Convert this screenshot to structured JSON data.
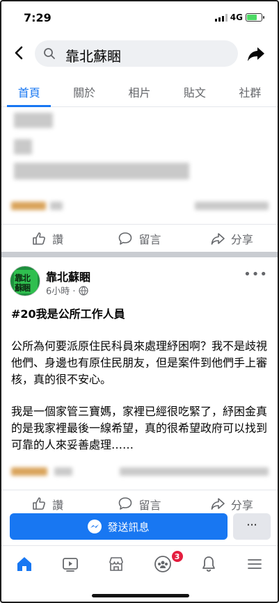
{
  "status": {
    "time": "7:29",
    "network": "4G"
  },
  "header": {
    "search_query": "靠北蘇睏"
  },
  "tabs": [
    {
      "label": "首頁",
      "active": true
    },
    {
      "label": "關於",
      "active": false
    },
    {
      "label": "相片",
      "active": false
    },
    {
      "label": "貼文",
      "active": false
    },
    {
      "label": "社群",
      "active": false
    }
  ],
  "actions": {
    "like": "讚",
    "comment": "留言",
    "share": "分享"
  },
  "post": {
    "page_name": "靠北蘇睏",
    "avatar_text_line1": "靠北",
    "avatar_text_line2": "蘇睏",
    "time": "6小時 ·",
    "title": "#20我是公所工作人員",
    "paragraph1": "公所為何要派原住民科員來處理紓困啊？我不是歧視他們、身邊也有原住民朋友，但是案件到他們手上審核，真的很不安心。",
    "paragraph2": "我是一個家管三寶媽，家裡已經很吃緊了，紓困金真的是我家裡最後一線希望，真的很希望政府可以找到可靠的人來妥善處理……"
  },
  "bottom": {
    "send_message": "發送訊息",
    "more": "···",
    "notification_badge": "3"
  },
  "colors": {
    "accent": "#1877f2",
    "badge": "#e41e3f",
    "battery": "#4cd964"
  }
}
